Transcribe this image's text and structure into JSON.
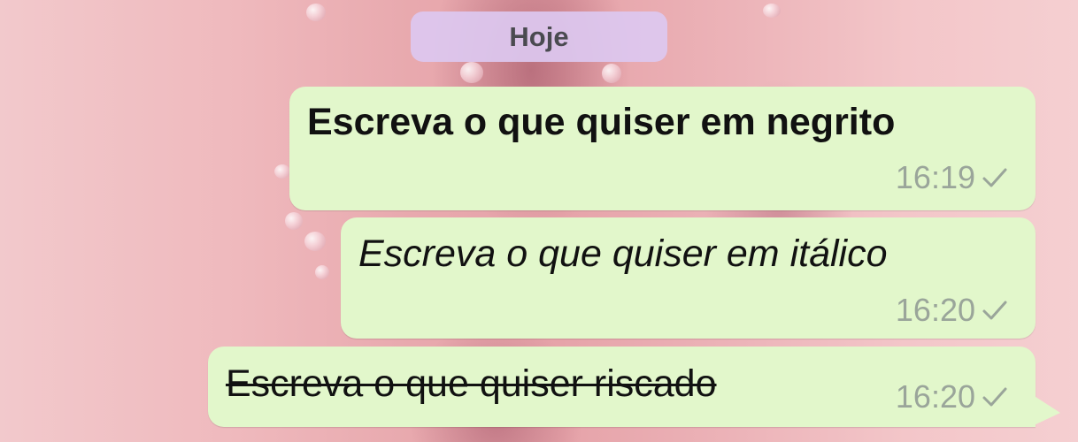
{
  "chat": {
    "date_label": "Hoje",
    "messages": [
      {
        "text": "Escreva o que quiser em negrito",
        "time": "16:19",
        "style": "bold",
        "status_icon": "single-check-icon"
      },
      {
        "text": "Escreva o que quiser em itálico",
        "time": "16:20",
        "style": "italic",
        "status_icon": "single-check-icon"
      },
      {
        "text": "Escreva o que quiser riscado",
        "time": "16:20",
        "style": "strikethrough",
        "status_icon": "single-check-icon"
      }
    ]
  },
  "colors": {
    "bubble": "#e2f7cb",
    "date_pill": "#dcc8f0",
    "timestamp": "#9aa59a",
    "wallpaper": "#e8a9ae"
  }
}
